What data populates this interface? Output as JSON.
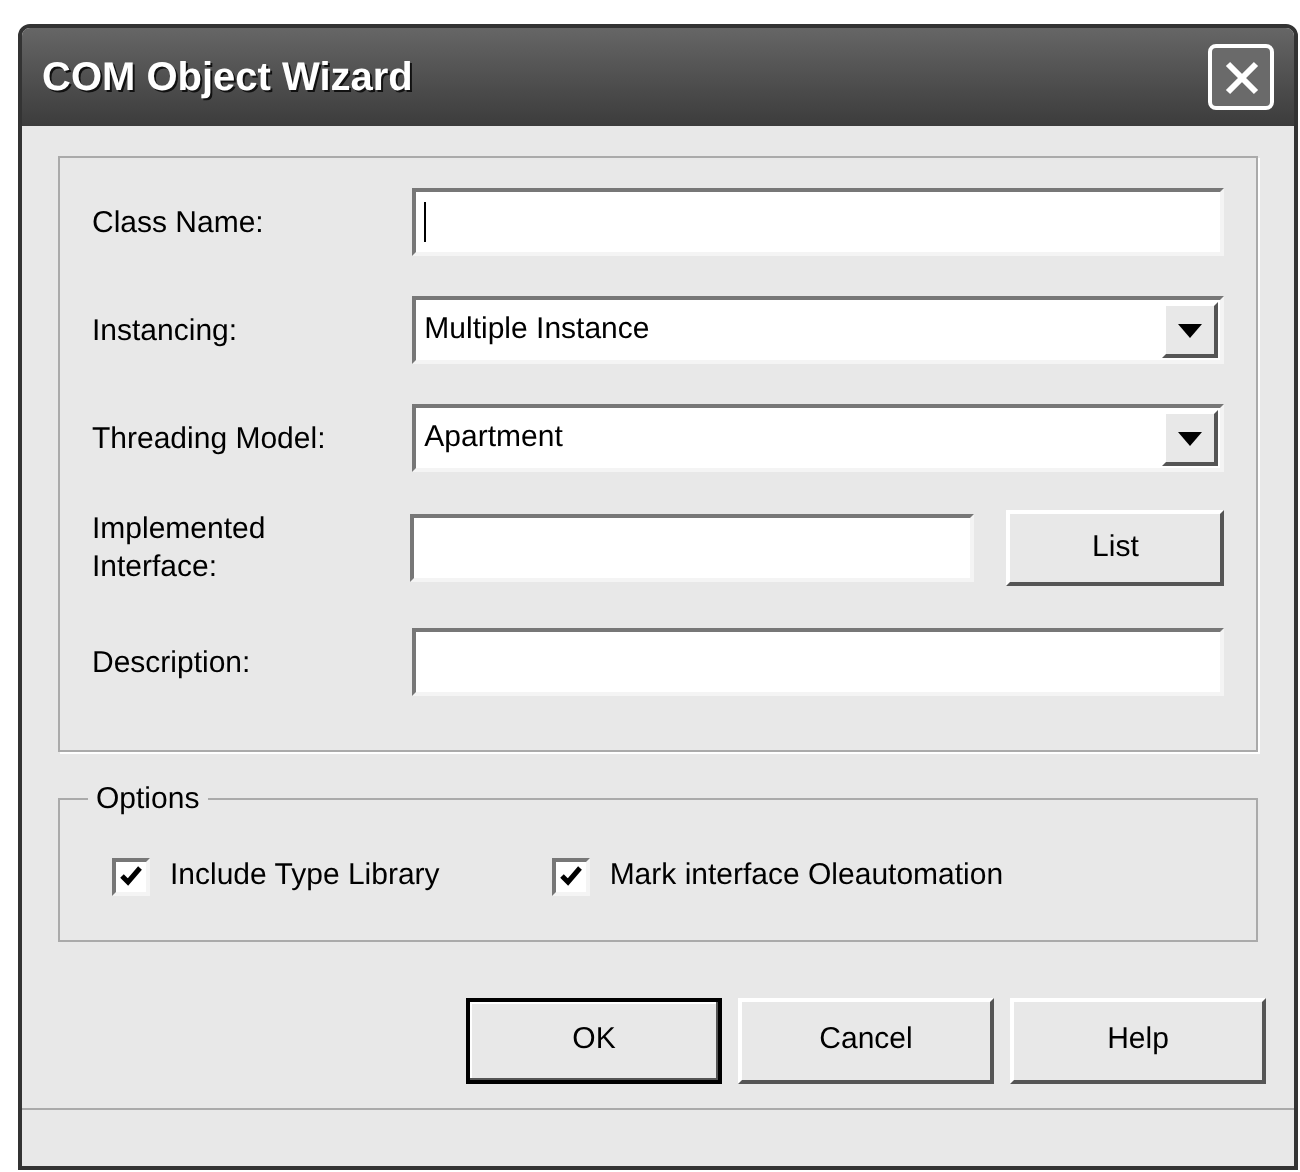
{
  "window": {
    "title": "COM Object Wizard"
  },
  "fields": [
    {
      "label": "Class Name:",
      "kind": "text",
      "focused": true
    },
    {
      "label": "Instancing:",
      "kind": "dropdown",
      "value": "Multiple Instance",
      "focused": false
    },
    {
      "label": "Threading Model:",
      "kind": "dropdown",
      "value": "Apartment",
      "focused": false
    },
    {
      "label": "Implemented Interface:",
      "kind": "text_with_button",
      "focused": false,
      "button": "List"
    },
    {
      "label": "Description:",
      "kind": "text",
      "focused": false
    }
  ],
  "options": {
    "title": "Options",
    "items": [
      {
        "label": "Include Type Library",
        "checked": true
      },
      {
        "label": "Mark interface Oleautomation",
        "checked": true
      }
    ]
  },
  "buttons": [
    {
      "label": "OK",
      "default": true
    },
    {
      "label": "Cancel",
      "default": false
    },
    {
      "label": "Help",
      "default": false
    }
  ]
}
